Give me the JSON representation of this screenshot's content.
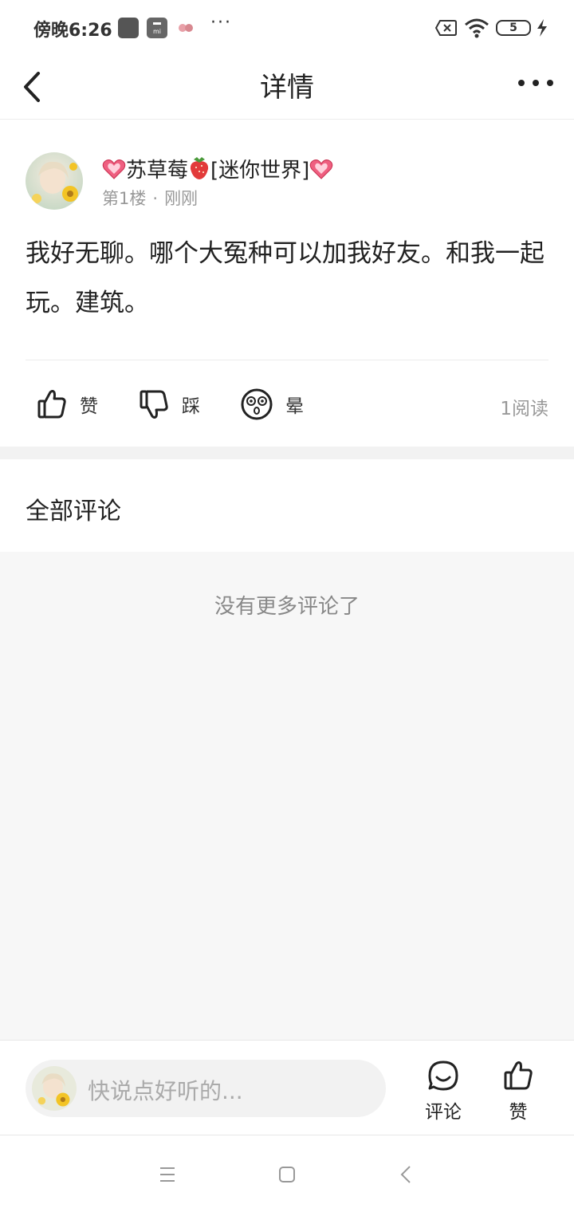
{
  "status_bar": {
    "time": "傍晚6:26",
    "overflow": "···",
    "battery": "5"
  },
  "header": {
    "title": "详情"
  },
  "post": {
    "author_name": "苏草莓",
    "author_tag": "[迷你世界]",
    "floor": "第1楼",
    "time": "刚刚",
    "content": "我好无聊。哪个大冤种可以加我好友。和我一起玩。建筑。",
    "actions": {
      "like": "赞",
      "dislike": "踩",
      "dizzy": "晕"
    },
    "read_count": "1阅读"
  },
  "comments": {
    "title": "全部评论",
    "empty_text": "没有更多评论了"
  },
  "bottom_bar": {
    "input_placeholder": "快说点好听的...",
    "comment_label": "评论",
    "like_label": "赞"
  },
  "colors": {
    "text": "#222222",
    "muted": "#999999",
    "comment_area_bg": "#f7f7f7"
  }
}
